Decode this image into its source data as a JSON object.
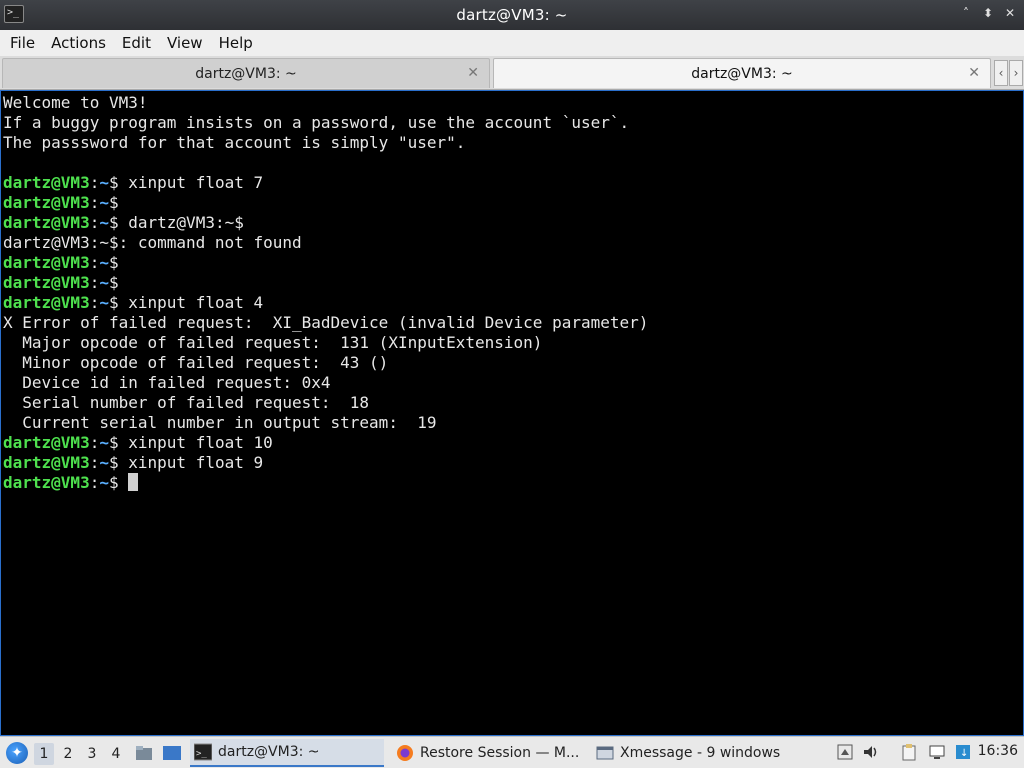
{
  "window": {
    "title": "dartz@VM3: ~",
    "buttons": [
      "˄",
      "⬍",
      "✕"
    ]
  },
  "menu": [
    "File",
    "Actions",
    "Edit",
    "View",
    "Help"
  ],
  "tabs": [
    {
      "label": "dartz@VM3: ~",
      "active": false
    },
    {
      "label": "dartz@VM3: ~",
      "active": true
    }
  ],
  "terminal": {
    "lines": [
      {
        "type": "text",
        "text": "Welcome to VM3!"
      },
      {
        "type": "text",
        "text": "If a buggy program insists on a password, use the account `user`."
      },
      {
        "type": "text",
        "text": "The passsword for that account is simply \"user\"."
      },
      {
        "type": "text",
        "text": ""
      },
      {
        "type": "prompt",
        "user": "dartz@VM3",
        "path": "~",
        "cmd": " xinput float 7"
      },
      {
        "type": "prompt",
        "user": "dartz@VM3",
        "path": "~",
        "cmd": ""
      },
      {
        "type": "prompt",
        "user": "dartz@VM3",
        "path": "~",
        "cmd": " dartz@VM3:~$"
      },
      {
        "type": "text",
        "text": "dartz@VM3:~$: command not found"
      },
      {
        "type": "prompt",
        "user": "dartz@VM3",
        "path": "~",
        "cmd": ""
      },
      {
        "type": "prompt",
        "user": "dartz@VM3",
        "path": "~",
        "cmd": ""
      },
      {
        "type": "prompt",
        "user": "dartz@VM3",
        "path": "~",
        "cmd": " xinput float 4"
      },
      {
        "type": "text",
        "text": "X Error of failed request:  XI_BadDevice (invalid Device parameter)"
      },
      {
        "type": "text",
        "text": "  Major opcode of failed request:  131 (XInputExtension)"
      },
      {
        "type": "text",
        "text": "  Minor opcode of failed request:  43 ()"
      },
      {
        "type": "text",
        "text": "  Device id in failed request: 0x4"
      },
      {
        "type": "text",
        "text": "  Serial number of failed request:  18"
      },
      {
        "type": "text",
        "text": "  Current serial number in output stream:  19"
      },
      {
        "type": "prompt",
        "user": "dartz@VM3",
        "path": "~",
        "cmd": " xinput float 10"
      },
      {
        "type": "prompt",
        "user": "dartz@VM3",
        "path": "~",
        "cmd": " xinput float 9"
      },
      {
        "type": "prompt",
        "user": "dartz@VM3",
        "path": "~",
        "cmd": " ",
        "cursor": true
      }
    ]
  },
  "taskbar": {
    "desktops": [
      "1",
      "2",
      "3",
      "4"
    ],
    "tasks": [
      {
        "label": "dartz@VM3: ~",
        "icon": "terminal-icon",
        "active": true
      },
      {
        "label": "Restore Session — M...",
        "icon": "firefox-icon",
        "active": false
      },
      {
        "label": "Xmessage - 9 windows",
        "icon": "window-icon",
        "active": false
      }
    ],
    "clock": "16:36"
  },
  "colors": {
    "prompt_user": "#4ee14e",
    "prompt_path": "#5bb0ff",
    "terminal_bg": "#000000",
    "accent": "#3a78c8"
  }
}
